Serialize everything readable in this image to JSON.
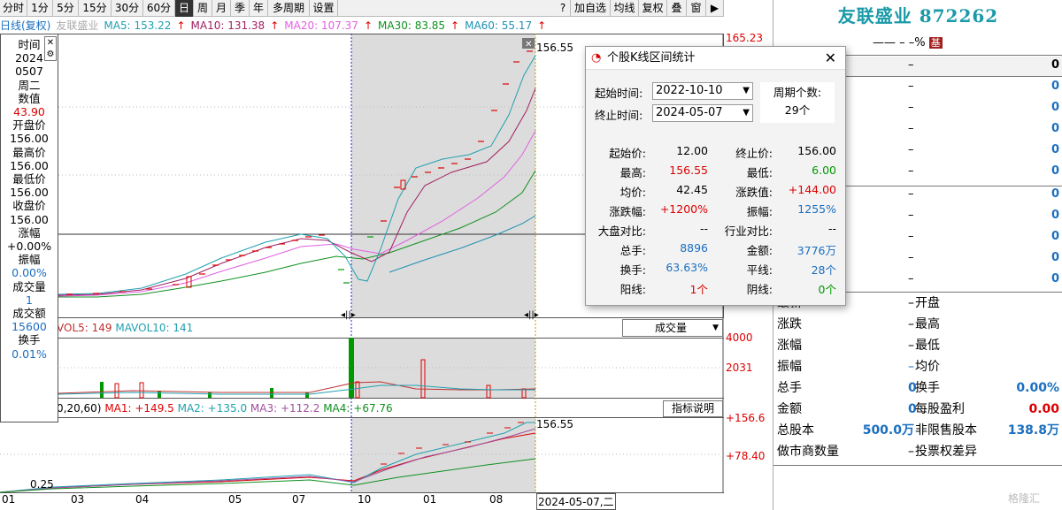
{
  "toolbar": {
    "periods": [
      "分时",
      "1分",
      "5分",
      "15分",
      "30分",
      "60分",
      "日",
      "周",
      "月",
      "季",
      "年",
      "多周期",
      "设置"
    ],
    "active": "日",
    "right_buttons": [
      "?",
      "加自选",
      "均线",
      "复权",
      "叠",
      "窗"
    ]
  },
  "ma_line": {
    "title": "日线(复权)",
    "stock_grey": "友联盛业",
    "ma5": "MA5: 153.22",
    "ma10": "MA10: 131.38",
    "ma20": "MA20: 107.37",
    "ma30": "MA30: 83.85",
    "ma60": "MA60: 55.17",
    "colors": {
      "ma5": "#20a0b0",
      "ma10": "#a02060",
      "ma20": "#e060e0",
      "ma30": "#109020",
      "ma60": "#2090b0"
    }
  },
  "info_panel": {
    "time_label": "时间",
    "year": "2024",
    "date": "0507",
    "weekday": "周二",
    "value_label": "数值",
    "value": "43.90",
    "open_label": "开盘价",
    "open": "156.00",
    "high_label": "最高价",
    "high": "156.00",
    "low_label": "最低价",
    "low": "156.00",
    "close_label": "收盘价",
    "close": "156.00",
    "change_label": "涨幅",
    "change": "+0.00%",
    "amp_label": "振幅",
    "amp": "0.00%",
    "vol_label": "成交量",
    "vol": "1",
    "amt_label": "成交额",
    "amt": "15600",
    "turn_label": "换手",
    "turn": "0.01%"
  },
  "price_axis": {
    "top": "165.23",
    "hi_marker": "156.55",
    "vol_top": "4000",
    "vol_mid": "2031",
    "ind_top": "+156.6",
    "ind_mid": "+78.40",
    "ind_marker": "156.55",
    "low_marker": "0.25"
  },
  "volume_line": {
    "vol5": "VOL5: 149",
    "mavol10": "MAVOL10: 141",
    "dropdown": "成交量"
  },
  "indicator_line": {
    "params": "0,20,60)",
    "ma1": "MA1: +149.5",
    "ma2": "MA2: +135.0",
    "ma3": "MA3: +112.2",
    "ma4": "MA4: +67.76",
    "button": "指标说明"
  },
  "x_axis": {
    "labels": [
      "01",
      "03",
      "04",
      "05",
      "07",
      "10",
      "01",
      "08"
    ],
    "cursor_date": "2024-05-07,二"
  },
  "right_panel": {
    "name": "友联盛业 872262",
    "sub": "—— – –%",
    "sub_badge": "基",
    "top_rows": [
      "–",
      "–",
      "–",
      "–",
      "–",
      "–",
      "–",
      "–",
      "–",
      "–",
      "–"
    ],
    "top_values": [
      "0",
      "0",
      "0",
      "0",
      "0",
      "0",
      "0",
      "0",
      "0",
      "0",
      "0"
    ],
    "rows": [
      {
        "l": "最新",
        "m": "–",
        "r_label": "开盘",
        "r": ""
      },
      {
        "l": "涨跌",
        "m": "–",
        "r_label": "最高",
        "r": ""
      },
      {
        "l": "涨幅",
        "m": "–",
        "r_label": "最低",
        "r": ""
      },
      {
        "l": "振幅",
        "m": "–",
        "r_label": "均价",
        "r": ""
      },
      {
        "l": "总手",
        "m": "0",
        "r_label": "换手",
        "r": "0.00%"
      },
      {
        "l": "金额",
        "m": "0",
        "r_label": "每股盈利",
        "r": "0.00"
      },
      {
        "l": "总股本",
        "m": "500.0万",
        "r_label": "非限售股本",
        "r": "138.8万"
      },
      {
        "l": "做市商数量",
        "m": "–",
        "r_label": "投票权差异",
        "r": ""
      }
    ],
    "watermark": "格隆汇"
  },
  "dialog": {
    "title": "个股K线区间统计",
    "start_label": "起始时间:",
    "start": "2022-10-10",
    "end_label": "终止时间:",
    "end": "2024-05-07",
    "period_label": "周期个数:",
    "period": "29个",
    "stats": [
      {
        "l": "起始价:",
        "v": "12.00",
        "c": "#000",
        "l2": "终止价:",
        "v2": "156.00",
        "c2": "#000"
      },
      {
        "l": "最高:",
        "v": "156.55",
        "c": "#d00",
        "l2": "最低:",
        "v2": "6.00",
        "c2": "#090"
      },
      {
        "l": "均价:",
        "v": "42.45",
        "c": "#000",
        "l2": "涨跌值:",
        "v2": "+144.00",
        "c2": "#d00"
      },
      {
        "l": "涨跌幅:",
        "v": "+1200%",
        "c": "#d00",
        "l2": "振幅:",
        "v2": "1255%",
        "c2": "#1a6fc0"
      },
      {
        "l": "大盘对比:",
        "v": "--",
        "c": "#000",
        "l2": "行业对比:",
        "v2": "--",
        "c2": "#000"
      },
      {
        "l": "总手:",
        "v": "8896",
        "c": "#1a6fc0",
        "l2": "金额:",
        "v2": "3776万",
        "c2": "#1a6fc0"
      },
      {
        "l": "换手:",
        "v": "63.63%",
        "c": "#1a6fc0",
        "l2": "平线:",
        "v2": "28个",
        "c2": "#1a6fc0"
      },
      {
        "l": "阳线:",
        "v": "1个",
        "c": "#d00",
        "l2": "阴线:",
        "v2": "0个",
        "c2": "#090"
      }
    ]
  }
}
